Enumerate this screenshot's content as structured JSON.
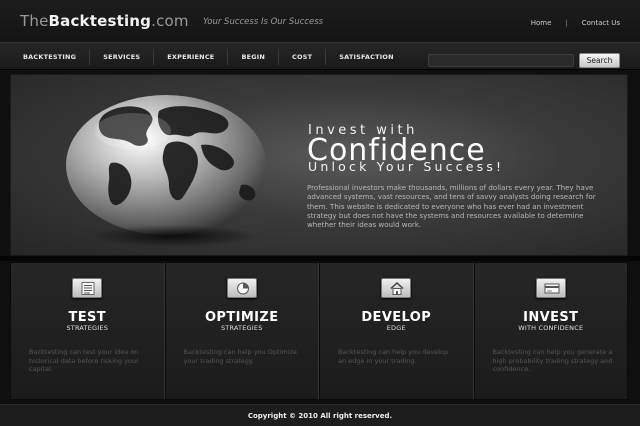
{
  "header": {
    "logo": {
      "part1": "The",
      "part2": "Backtesting",
      "part3": ".com"
    },
    "tagline": "Your Success Is Our Success",
    "links": [
      "Home",
      "Contact Us"
    ],
    "separator": "|"
  },
  "nav": {
    "items": [
      "BACKTESTING",
      "SERVICES",
      "EXPERIENCE",
      "BEGIN",
      "COST",
      "SATISFACTION"
    ],
    "search": {
      "placeholder": "",
      "button_label": "Search"
    }
  },
  "hero": {
    "line1": "Invest with",
    "line2": "Confidence",
    "line3": "Unlock Your Success!",
    "paragraph": "Professional investors make thousands, millions of dollars every year. They have advanced systems, vast resources, and tens of savvy analysts doing research for them. This website is dedicated to everyone who has ever had an investment strategy but does not have the systems and resources available to determine whether their ideas would work.",
    "image_icon": "globe-icon"
  },
  "features": [
    {
      "title": "TEST",
      "subtitle": "STRATEGIES",
      "icon": "document-icon",
      "description": "Backtesting can test your idea on historical data before risking your capital."
    },
    {
      "title": "OPTIMIZE",
      "subtitle": "STRATEGIES",
      "icon": "pie-chart-icon",
      "description": "Backtesting can help you Optimize your trading strategy."
    },
    {
      "title": "DEVELOP",
      "subtitle": "EDGE",
      "icon": "house-icon",
      "description": "Backtesting can help you develop an edge in your trading."
    },
    {
      "title": "INVEST",
      "subtitle": "WITH CONFIDENCE",
      "icon": "card-icon",
      "description": "Backtesting can help you generate a high probability trading strategy and confidence."
    }
  ],
  "footer": {
    "copyright": "Copyright © 2010 All right reserved."
  },
  "colors": {
    "background": "#0f0f0f",
    "panel": "#262626",
    "text": "#ffffff",
    "muted": "#555555"
  }
}
